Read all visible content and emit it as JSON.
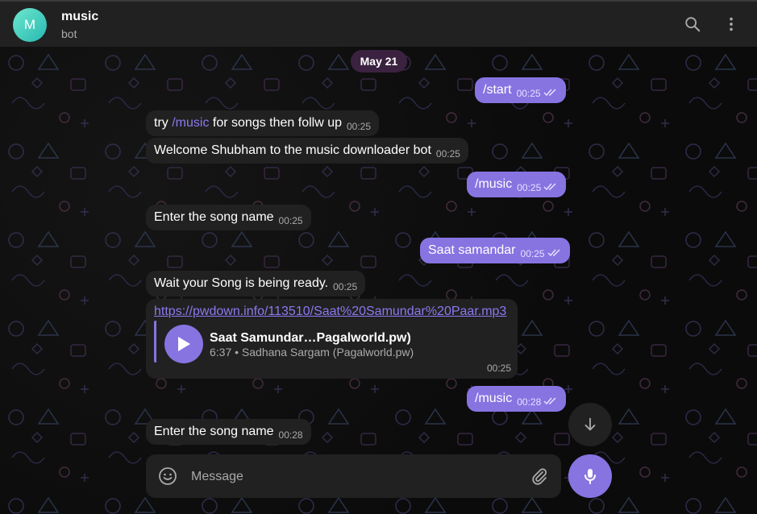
{
  "header": {
    "avatar_letter": "M",
    "title": "music",
    "subtitle": "bot",
    "search_icon": "search-icon",
    "menu_icon": "more-vertical-icon"
  },
  "chat": {
    "date_chip": "May 21",
    "messages": [
      {
        "dir": "out",
        "text": "/start",
        "time": "00:25",
        "status": "read"
      },
      {
        "dir": "in",
        "prefix": "try ",
        "command": "/music",
        "suffix": " for songs then follw up",
        "time": "00:25"
      },
      {
        "dir": "in",
        "text": "Welcome Shubham to the music downloader bot",
        "time": "00:25"
      },
      {
        "dir": "out",
        "text": "/music",
        "time": "00:25",
        "status": "read"
      },
      {
        "dir": "in",
        "text": "Enter the song name",
        "time": "00:25"
      },
      {
        "dir": "out",
        "text": "Saat samandar",
        "time": "00:25",
        "status": "read"
      },
      {
        "dir": "in",
        "text": "Wait your Song is being ready.",
        "time": "00:25"
      },
      {
        "dir": "in",
        "type": "audio",
        "url": "https://pwdown.info/113510/Saat%20Samundar%20Paar.mp3",
        "audio_title": "Saat Samundar…Pagalworld.pw)",
        "audio_meta": "6:37 • Sadhana Sargam (Pagalworld.pw)",
        "time": "00:25"
      },
      {
        "dir": "out",
        "text": "/music",
        "time": "00:28",
        "status": "read"
      },
      {
        "dir": "in",
        "text": "Enter the song name",
        "time": "00:28"
      }
    ]
  },
  "composer": {
    "placeholder": "Message",
    "emoji_icon": "smile-icon",
    "attach_icon": "paperclip-icon",
    "mic_icon": "microphone-icon",
    "scroll_icon": "arrow-down-icon"
  },
  "colors": {
    "accent": "#8774e1",
    "incoming_bubble": "#212121",
    "header_bg": "#212121",
    "background": "#0f0f0f",
    "date_chip_bg": "#3b2240"
  }
}
